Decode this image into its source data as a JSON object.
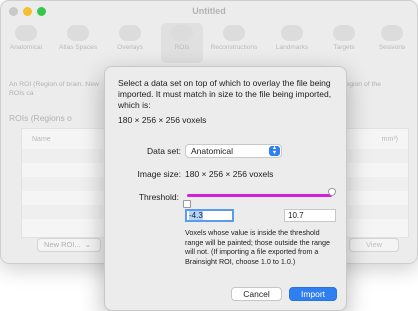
{
  "window": {
    "title": "Untitled",
    "traffic_lights": [
      "close-icon",
      "minimize-icon",
      "zoom-icon"
    ]
  },
  "toolbar": {
    "items": [
      {
        "label": "Anatomical",
        "icon": "brain-icon"
      },
      {
        "label": "Atlas Spaces",
        "icon": "brain-icon"
      },
      {
        "label": "Overlays",
        "icon": "brain-icon"
      },
      {
        "label": "ROIs",
        "icon": "brain-icon",
        "selected": true
      },
      {
        "label": "Reconstructions",
        "icon": "head-icon"
      },
      {
        "label": "Landmarks",
        "icon": "head-icon"
      },
      {
        "label": "Targets",
        "icon": "brain-icon"
      },
      {
        "label": "Sessions",
        "icon": "brain-icon"
      }
    ]
  },
  "background": {
    "desc_left": "An ROI (Region of brain. New ROIs ca",
    "desc_right": "ific region of the",
    "section_title": "ROIs (Regions o",
    "col_name": "Name",
    "col_volume": "mm³)",
    "new_roi_label": "New ROI...",
    "new_roi_chevron": "⌄",
    "view_label": "View"
  },
  "sheet": {
    "prompt": "Select a data set on top of which to overlay the file being imported. It must match in size to the file being imported, which is:",
    "import_dims": "180 × 256 × 256 voxels",
    "dataset_label": "Data set:",
    "dataset_value": "Anatomical",
    "image_size_label": "Image size:",
    "image_size_value": "180 × 256 × 256 voxels",
    "threshold_label": "Threshold:",
    "threshold_min": "-4.3",
    "threshold_max": "10.7",
    "explanation": "Voxels whose value is inside the threshold range will be painted; those outside the range will not. (If importing a file exported from a Brainsight ROI, choose 1.0 to 1.0.)",
    "cancel_label": "Cancel",
    "import_label": "Import",
    "accent_color": "#2f7ff1",
    "slider_color": "#d51fe0"
  }
}
